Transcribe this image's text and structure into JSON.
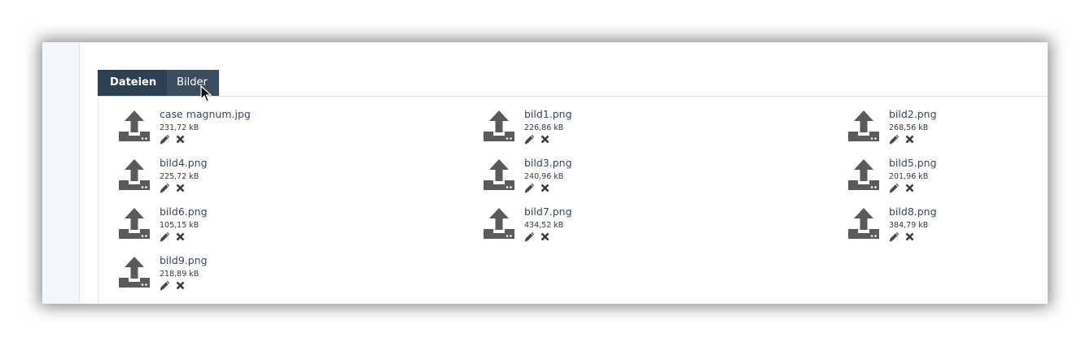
{
  "tabs": [
    {
      "label": "Dateien",
      "active": true
    },
    {
      "label": "Bilder",
      "active": false
    }
  ],
  "icons": {
    "upload": "upload-icon",
    "edit": "pencil-icon",
    "delete": "close-icon"
  },
  "colors": {
    "tab_bar": "#2d4052",
    "icon": "#5a5a5a",
    "filename": "#34495e"
  },
  "files": [
    {
      "name": "case magnum.jpg",
      "size": "231,72 kB"
    },
    {
      "name": "bild1.png",
      "size": "226,86 kB"
    },
    {
      "name": "bild2.png",
      "size": "268,56 kB"
    },
    {
      "name": "bild4.png",
      "size": "225,72 kB"
    },
    {
      "name": "bild3.png",
      "size": "240,96 kB"
    },
    {
      "name": "bild5.png",
      "size": "201,96 kB"
    },
    {
      "name": "bild6.png",
      "size": "105,15 kB"
    },
    {
      "name": "bild7.png",
      "size": "434,52 kB"
    },
    {
      "name": "bild8.png",
      "size": "384,79 kB"
    },
    {
      "name": "bild9.png",
      "size": "218,89 kB"
    }
  ]
}
